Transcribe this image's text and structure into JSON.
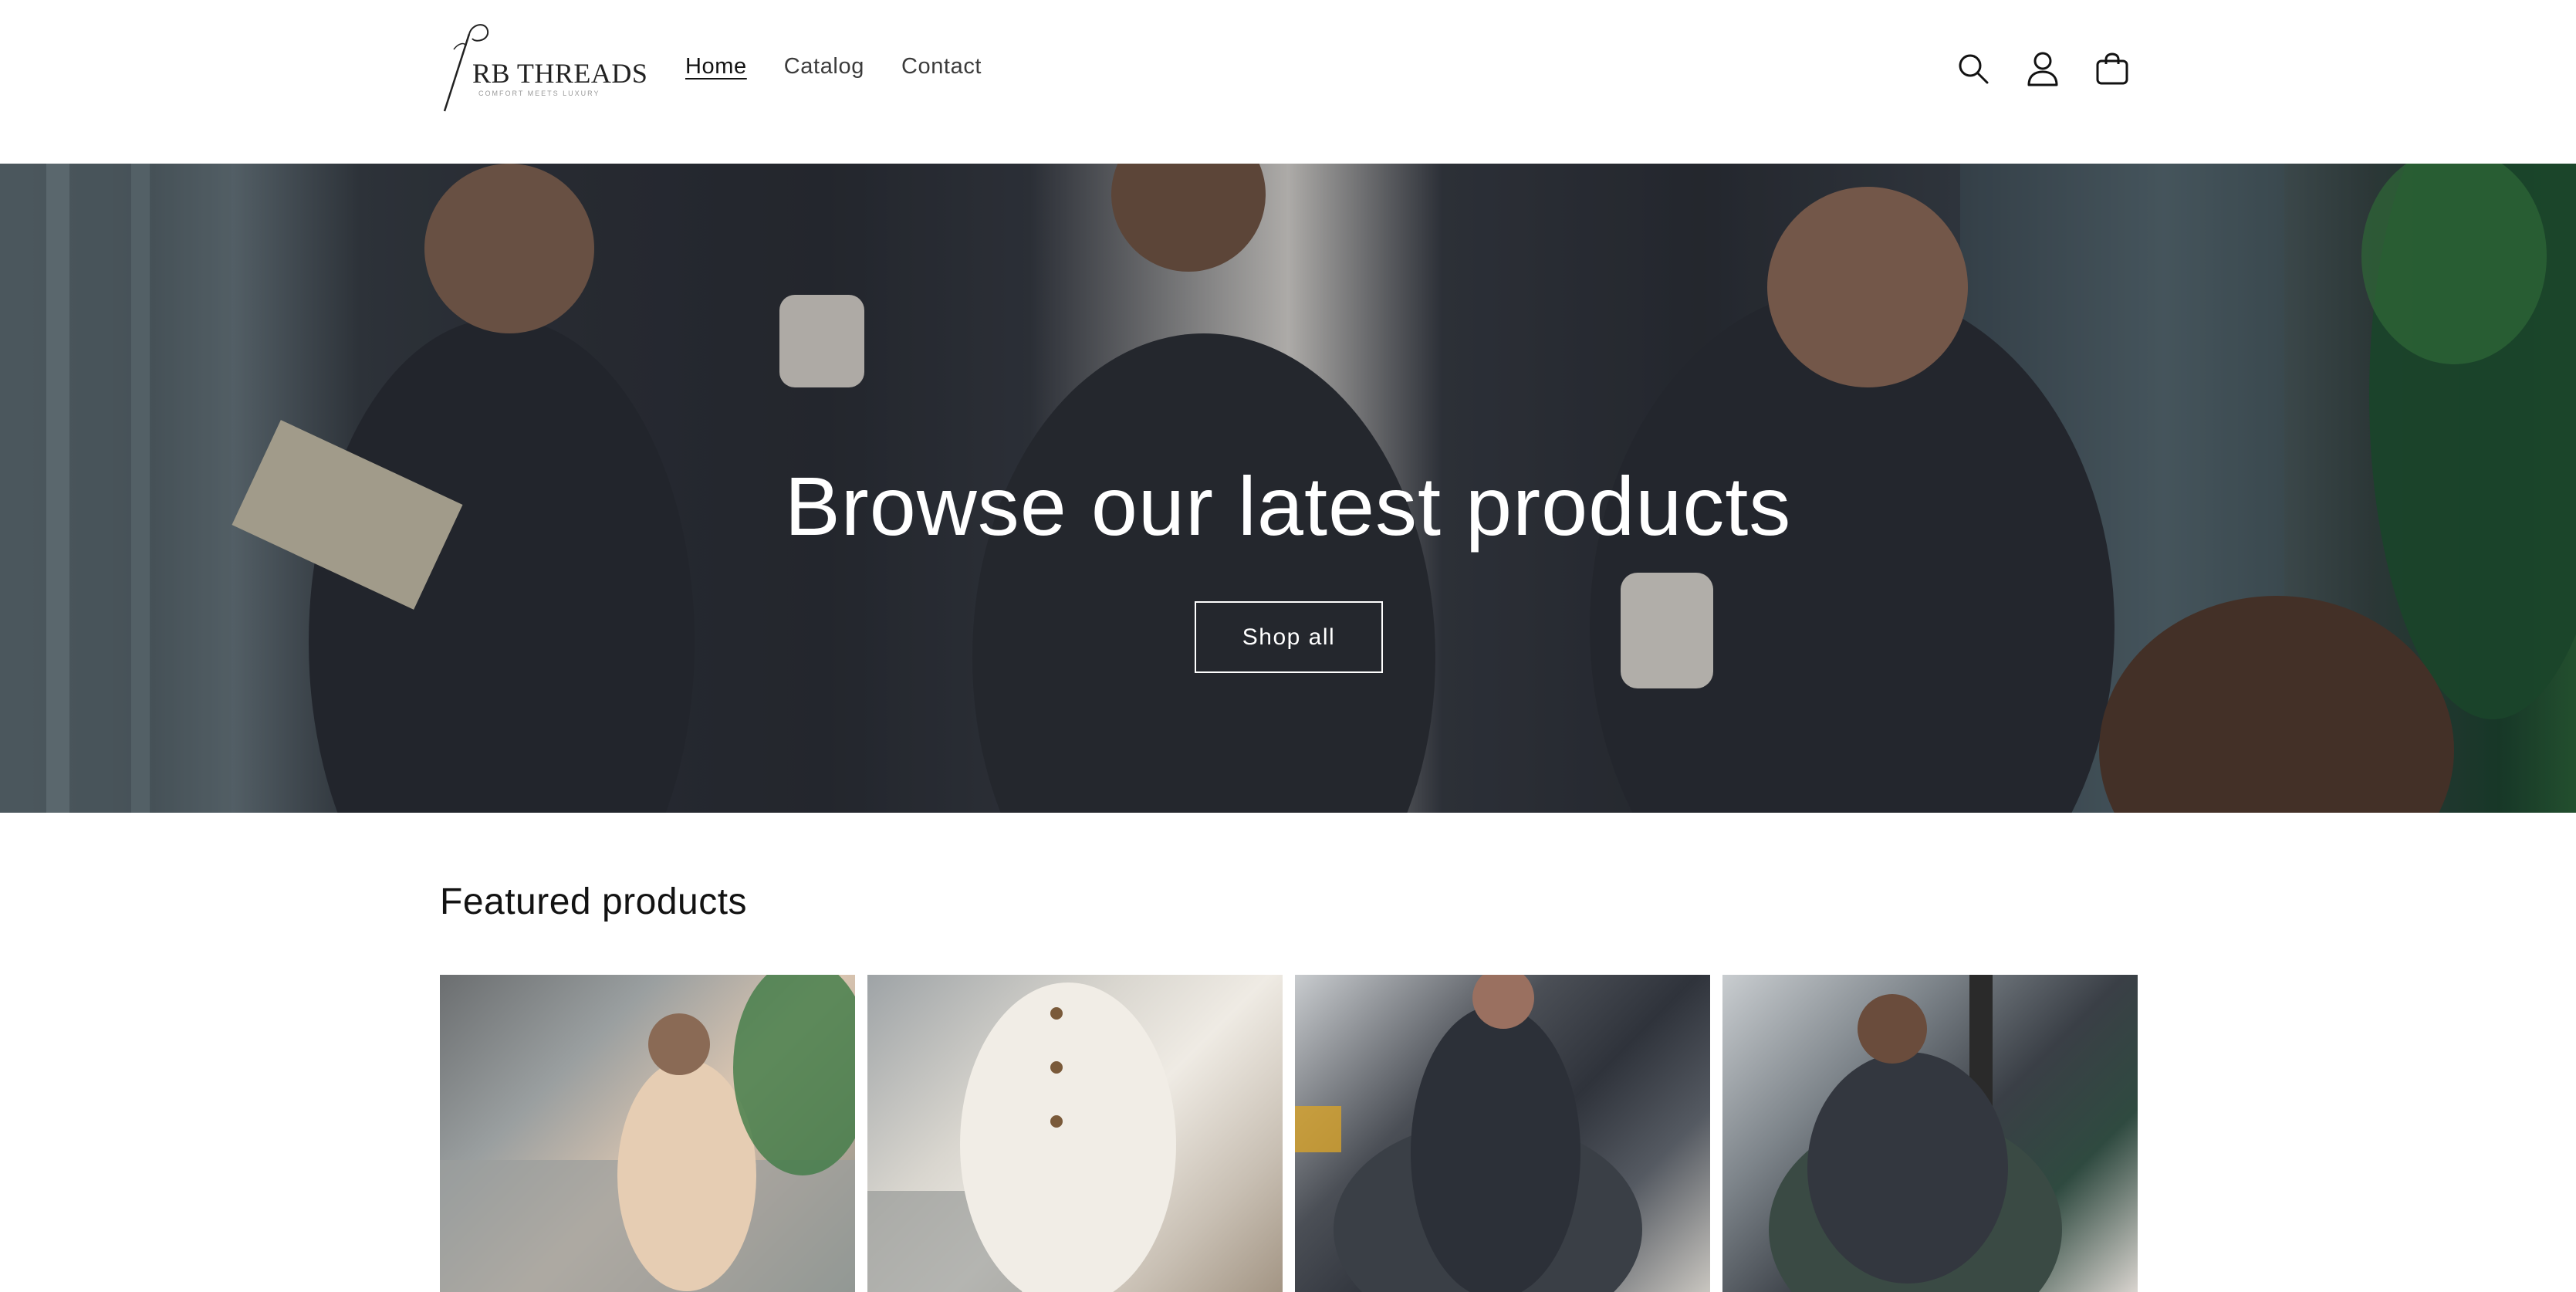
{
  "header": {
    "logo_name": "RB THREADS",
    "logo_tagline": "COMFORT MEETS LUXURY",
    "nav": [
      {
        "label": "Home",
        "active": true
      },
      {
        "label": "Catalog",
        "active": false
      },
      {
        "label": "Contact",
        "active": false
      }
    ],
    "icons": [
      "search-icon",
      "account-icon",
      "cart-icon"
    ]
  },
  "hero": {
    "title": "Browse our latest products",
    "button_label": "Shop all"
  },
  "featured": {
    "title": "Featured products",
    "products": [
      {
        "image": "woman-beige-pajama-on-sofa"
      },
      {
        "image": "man-white-shirt-standing"
      },
      {
        "image": "woman-grey-striped-pajama-in-chair"
      },
      {
        "image": "man-grey-pajama-in-chair"
      }
    ]
  },
  "colors": {
    "text": "#121212",
    "background": "#ffffff",
    "hero_text": "#ffffff"
  }
}
